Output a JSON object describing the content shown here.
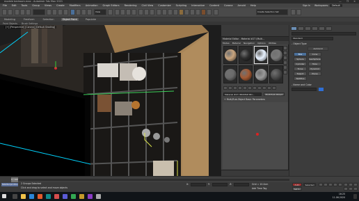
{
  "window": {
    "title": "modele bedroom.max - Autodesk 3ds Max 2021",
    "controls": "— ❐ ✕"
  },
  "menu": [
    "File",
    "Edit",
    "Tools",
    "Group",
    "Views",
    "Create",
    "Modifiers",
    "Animation",
    "Graph Editors",
    "Rendering",
    "Civil View",
    "Customize",
    "Scripting",
    "Interactive",
    "Content",
    "Corona",
    "Arnold",
    "Help"
  ],
  "workspace": {
    "sign_in": "Sign In",
    "workspaces_label": "Workspaces:",
    "workspaces_value": "Default"
  },
  "toolbar": {
    "view_dropdown": "View",
    "selection_set": "Create Selection Set"
  },
  "ribbon": {
    "tabs": [
      "Modeling",
      "Freeform",
      "Selection",
      "Object Paint",
      "Populate"
    ],
    "active_tab": "Object Paint",
    "subtabs": [
      "Paint Objects",
      "Brush Settings"
    ]
  },
  "viewport": {
    "label": "[+] [Perspective] [Corona] [Default Shading]"
  },
  "material_editor": {
    "title": "Material Editor - Material #27 (Multi...",
    "menu": [
      "Modes",
      "Material",
      "Navigation",
      "Options",
      "Utilities"
    ],
    "slot_colors": [
      "#c9a57f",
      "#2d2d2d",
      "#e8f2ff",
      "#7a7a7a",
      "#6b6b6b",
      "#a45a34",
      "#9a9a9a",
      "#4a4a4a"
    ],
    "active_slot": 2,
    "name_value": "Material #27 (MODELE BD...",
    "type_value": "Multi/Sub-Object",
    "rollout_title": "Multi/Sub-Object Basic Parameters"
  },
  "command_panel": {
    "dropdown": "Standard",
    "object_type_title": "Object Type",
    "autogrid": "AutoGrid",
    "buttons": [
      "Box",
      "Cone",
      "Sphere",
      "GeoSphere",
      "Cylinder",
      "Tube",
      "Torus",
      "Pyramid",
      "Teapot",
      "Plane",
      "TextPlus"
    ],
    "selected_button": "Box",
    "name_color_title": "Name and Color",
    "object_color": "#2f6fd6"
  },
  "timeline": {
    "frame": "0 / 100"
  },
  "status": {
    "maxscript": "MAXScript Mini",
    "selected": "2 Groups Selected",
    "prompt": "Click and drag to select and move objects",
    "x_label": "X:",
    "y_label": "Y:",
    "z_label": "Z:",
    "grid": "Grid = 10.0cm",
    "add_time_tag": "Add Time Tag",
    "auto": "Auto",
    "set_key": "Set K.",
    "selected_dropdown": "Selected"
  },
  "taskbar": {
    "time": "16:25",
    "date": "11.06.2020"
  }
}
